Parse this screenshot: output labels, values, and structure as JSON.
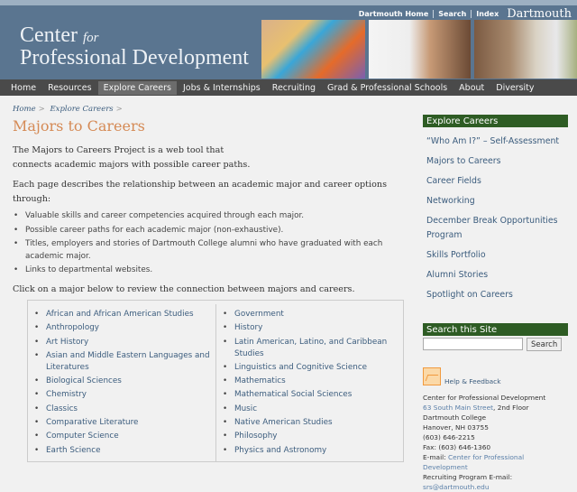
{
  "header": {
    "top_links": [
      "Dartmouth Home",
      "Search",
      "Index"
    ],
    "dartmouth_logo": "Dartmouth",
    "site_title_line1": "Center",
    "site_title_for": "for",
    "site_title_line2": "Professional Development"
  },
  "nav": {
    "items": [
      "Home",
      "Resources",
      "Explore Careers",
      "Jobs & Internships",
      "Recruiting",
      "Grad & Professional Schools",
      "About",
      "Diversity"
    ],
    "active": "Explore Careers"
  },
  "breadcrumb": [
    "Home",
    "Explore Careers"
  ],
  "breadcrumb_sep": ">",
  "page_title": "Majors to Careers",
  "intro": "The Majors to Careers Project is a web tool that connects academic majors with possible career paths.",
  "description": "Each page describes the relationship between an academic major and career options through:",
  "bullets": [
    "Valuable skills and career competencies acquired through each major.",
    "Possible career paths for each academic major (non-exhaustive).",
    "Titles, employers and stories of Dartmouth College alumni who have graduated with each academic major.",
    "Links to departmental websites."
  ],
  "click_text": "Click on a major below to review the connection between majors and careers.",
  "majors_left": [
    "African and African American Studies",
    "Anthropology",
    "Art History",
    "Asian and Middle Eastern Languages and Literatures",
    "Biological Sciences",
    "Chemistry",
    "Classics",
    "Comparative Literature",
    "Computer Science",
    "Earth Science"
  ],
  "majors_right": [
    "Government",
    "History",
    "Latin American, Latino, and Caribbean Studies",
    "Linguistics and Cognitive Science",
    "Mathematics",
    "Mathematical Social Sciences",
    "Music",
    "Native American Studies",
    "Philosophy",
    "Physics and Astronomy"
  ],
  "sidebar": {
    "explore_heading": "Explore Careers",
    "links": [
      "“Who Am I?” – Self-Assessment",
      "Majors to Careers",
      "Career Fields",
      "Networking",
      "December Break Opportunities Program",
      "Skills Portfolio",
      "Alumni Stories",
      "Spotlight on Careers"
    ],
    "search_heading": "Search this Site",
    "search_value": "",
    "search_button": "Search",
    "help_label": "Help & Feedback",
    "contact": {
      "org": "Center for Professional Development",
      "street_link": "63 South Main Street",
      "street_rest": ", 2nd Floor",
      "college": "Dartmouth College",
      "city": "Hanover, NH 03755",
      "phone": "(603) 646-2215",
      "fax": "Fax: (603) 646-1360",
      "email_label": "E-mail: ",
      "email_link": "Center for Professional Development",
      "recruiting_label": "Recruiting Program E-mail: ",
      "recruiting_email": "srs@dartmouth.edu"
    }
  },
  "colors": {
    "header": "#5a7590",
    "nav": "#4a4a4a",
    "title": "#d58a55",
    "sidebar_heading": "#2e5c24",
    "link": "#3b5c7d"
  }
}
